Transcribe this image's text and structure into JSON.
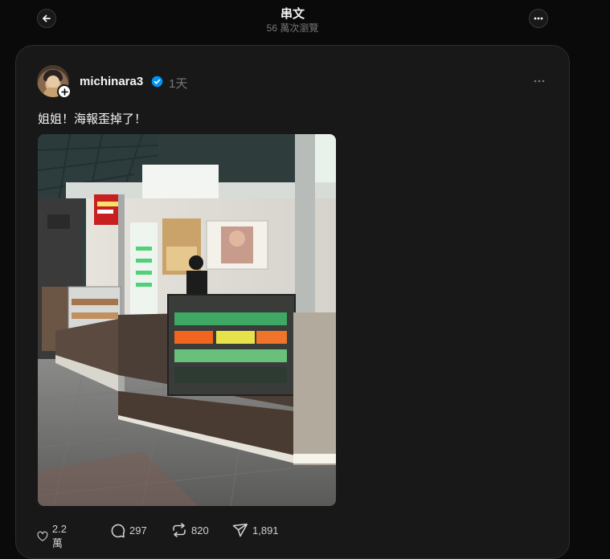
{
  "header": {
    "title": "串文",
    "views": "56 萬次瀏覽"
  },
  "post": {
    "username": "michinara3",
    "time": "1天",
    "text": "姐姐！海報歪掉了！",
    "image_alt": "Photo of a food kiosk with display cases and a crooked poster",
    "store_sign_red": "優波蛋",
    "store_sign_green": "三禾苗"
  },
  "actions": {
    "likes": "2.2 萬",
    "comments": "297",
    "reposts": "820",
    "shares": "1,891"
  },
  "colors": {
    "background": "#0a0a0a",
    "card": "#181818",
    "verified": "#0095f6",
    "muted": "#777777"
  },
  "icons": [
    "back-arrow-icon",
    "more-icon",
    "verified-badge-icon",
    "plus-icon",
    "heart-icon",
    "comment-icon",
    "repost-icon",
    "send-icon"
  ]
}
